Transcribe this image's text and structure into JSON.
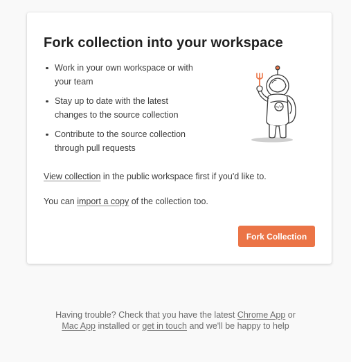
{
  "dialog": {
    "title": "Fork collection into your workspace",
    "features": [
      "Work in your own workspace or with your team",
      "Stay up to date with the latest changes to the source collection",
      "Contribute to the source collection through pull requests"
    ],
    "view_link": "View collection",
    "view_rest": " in the public workspace first if you'd like to.",
    "import_prefix": "You can ",
    "import_link": "import a copy",
    "import_suffix": " of the collection too.",
    "fork_button": "Fork Collection"
  },
  "illustration": {
    "icon": "astronaut-with-fork-icon",
    "badge_text": "</>"
  },
  "footer": {
    "text1": "Having trouble? Check that you have the latest ",
    "chrome_link": "Chrome App",
    "text2": " or",
    "mac_link": "Mac App",
    "text3": " installed or ",
    "touch_link": "get in touch",
    "text4": " and we'll be happy to help"
  },
  "colors": {
    "accent": "#eb7446",
    "background": "#f9f9f9",
    "card": "#ffffff"
  }
}
